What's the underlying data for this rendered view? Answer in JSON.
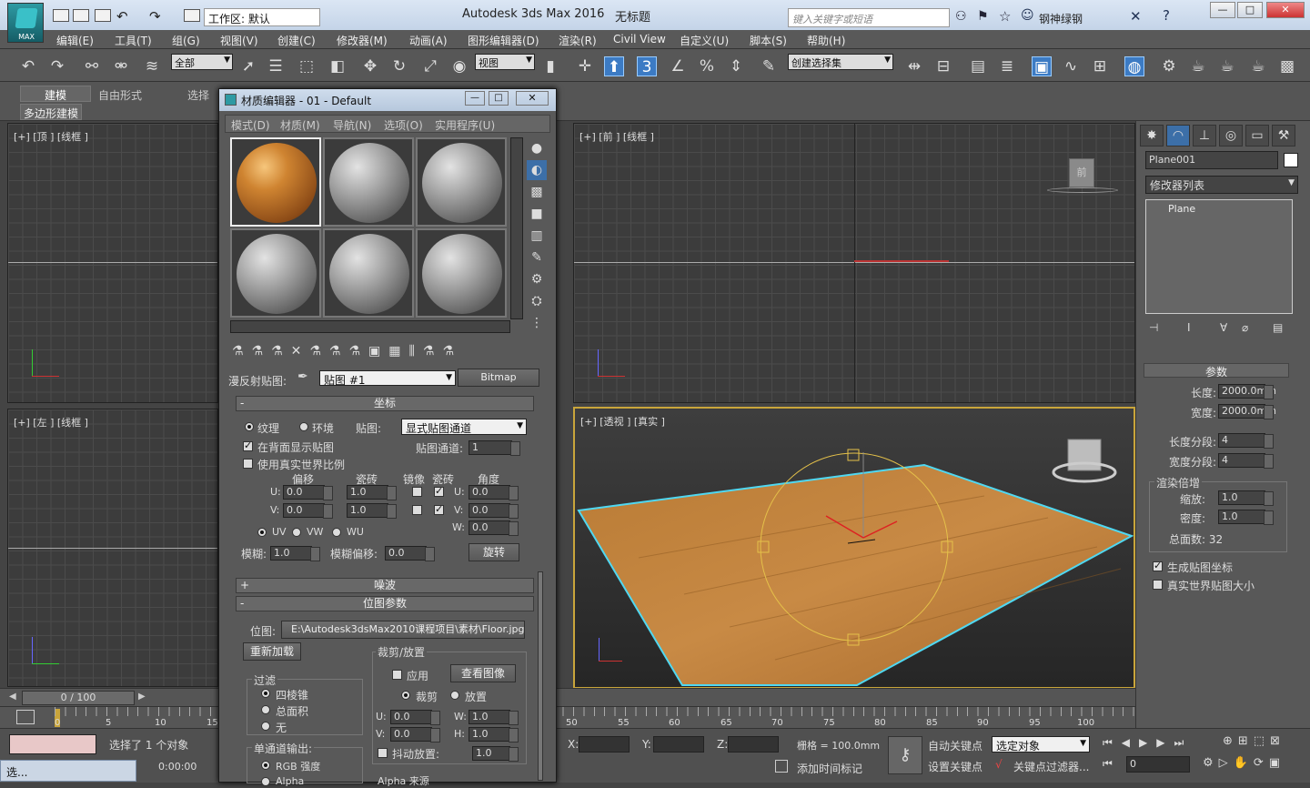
{
  "app": {
    "logo_text": "MAX",
    "title": "Autodesk 3ds Max 2016",
    "file": "无标题",
    "workspace": "工作区: 默认",
    "search_placeholder": "键入关键字或短语",
    "user": "钢神绿钢"
  },
  "menus": [
    "编辑(E)",
    "工具(T)",
    "组(G)",
    "视图(V)",
    "创建(C)",
    "修改器(M)",
    "动画(A)",
    "图形编辑器(D)",
    "渲染(R)",
    "Civil View",
    "自定义(U)",
    "脚本(S)",
    "帮助(H)"
  ],
  "toolbar": {
    "filter": "全部",
    "ref_coord": "视图",
    "selection_set": "创建选择集",
    "snap_label": "3"
  },
  "ribbon": {
    "tabs": [
      "建模",
      "自由形式",
      "选择"
    ],
    "sub": "多边形建模"
  },
  "viewports": {
    "top": "[+] [顶 ] [线框 ]",
    "front": "[+] [前 ] [线框 ]",
    "left": "[+] [左 ] [线框 ]",
    "persp": "[+] [透视 ] [真实 ]",
    "viewcube_front": "前"
  },
  "material_editor": {
    "title": "材质编辑器 - 01 - Default",
    "menu": [
      "模式(D)",
      "材质(M)",
      "导航(N)",
      "选项(O)",
      "实用程序(U)"
    ],
    "diffuse_label": "漫反射贴图:",
    "map_name": "贴图 #1",
    "map_type": "Bitmap",
    "coords": {
      "header": "坐标",
      "texture": "纹理",
      "environ": "环境",
      "mapping_label": "贴图:",
      "mapping": "显式贴图通道",
      "show_back": "在背面显示贴图",
      "channel_label": "贴图通道:",
      "channel": "1",
      "real_world": "使用真实世界比例",
      "col_offset": "偏移",
      "col_tiling": "瓷砖",
      "col_mirror": "镜像",
      "col_tile": "瓷砖",
      "col_angle": "角度",
      "u": "U:",
      "v": "V:",
      "w": "W:",
      "u_offset": "0.0",
      "v_offset": "0.0",
      "u_tiling": "1.0",
      "v_tiling": "1.0",
      "u_angle": "0.0",
      "v_angle": "0.0",
      "w_angle": "0.0",
      "uv": "UV",
      "vw": "VW",
      "wu": "WU",
      "blur_label": "模糊:",
      "blur": "1.0",
      "blur_offset_label": "模糊偏移:",
      "blur_offset": "0.0",
      "rotate": "旋转"
    },
    "noise_header": "噪波",
    "bitmap_header": "位图参数",
    "bitmap": {
      "path_label": "位图:",
      "path": "E:\\Autodesk3dsMax2010课程项目\\素材\\Floor.jpg",
      "reload": "重新加载",
      "crop_group": "裁剪/放置",
      "apply": "应用",
      "view_image": "查看图像",
      "crop": "裁剪",
      "place": "放置",
      "u": "U:",
      "v": "V:",
      "w": "W:",
      "h": "H:",
      "u_val": "0.0",
      "v_val": "0.0",
      "w_val": "1.0",
      "h_val": "1.0",
      "jitter": "抖动放置:",
      "jitter_val": "1.0",
      "filter_group": "过滤",
      "pyramidal": "四棱锥",
      "summed": "总面积",
      "none": "无",
      "mono_group": "单通道输出:",
      "rgb": "RGB 强度",
      "alpha": "Alpha",
      "alpha_src": "Alpha 来源"
    }
  },
  "command_panel": {
    "object_name": "Plane001",
    "modifier_list": "修改器列表",
    "stack_item": "Plane",
    "params": "参数",
    "length_label": "长度:",
    "length": "2000.0mm",
    "width_label": "宽度:",
    "width": "2000.0mm",
    "len_segs_label": "长度分段:",
    "len_segs": "4",
    "wid_segs_label": "宽度分段:",
    "wid_segs": "4",
    "render_mult": "渲染倍增",
    "scale_label": "缩放:",
    "scale": "1.0",
    "density_label": "密度:",
    "density": "1.0",
    "total_faces": "总面数: 32",
    "gen_coords": "生成贴图坐标",
    "real_world": "真实世界贴图大小"
  },
  "timeline": {
    "frame": "0 / 100",
    "ticks": [
      "0",
      "5",
      "10",
      "15",
      "50",
      "55",
      "60",
      "65",
      "70",
      "75",
      "80",
      "85",
      "90",
      "95",
      "100"
    ]
  },
  "status": {
    "selected": "选择了 1 个对象",
    "time": "0:00:00",
    "x_label": "X:",
    "y_label": "Y:",
    "z_label": "Z:",
    "grid": "栅格 = 100.0mm",
    "add_tag": "添加时间标记",
    "auto_key": "自动关键点",
    "set_key": "设置关键点",
    "selected_obj": "选定对象",
    "key_filter": "关键点过滤器...",
    "frame_field": "0",
    "taskbar_item": "选..."
  }
}
